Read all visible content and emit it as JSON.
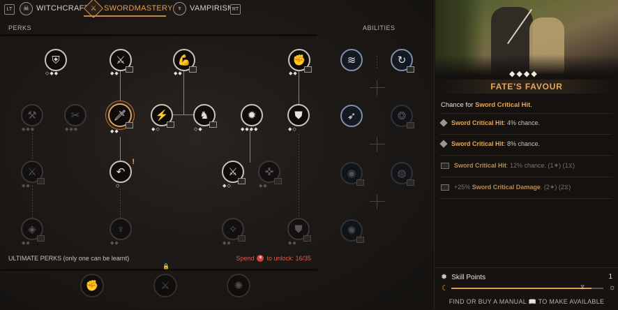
{
  "tabs": [
    {
      "key": "LT",
      "label": "WITCHCRAFT",
      "icon": "skull-icon",
      "active": false
    },
    {
      "key": "",
      "label": "SWORDMASTERY",
      "icon": "sword-icon",
      "active": true
    },
    {
      "key": "RT",
      "label": "VAMPIRISM",
      "icon": "vampire-icon",
      "active": false
    }
  ],
  "tab_keys": {
    "left": "LT",
    "right": "RT"
  },
  "sections": {
    "perks": "PERKS",
    "abilities": "ABILITIES"
  },
  "ultimate": {
    "label": "ULTIMATE PERKS (only one can be learnt)",
    "spend_prefix": "Spend",
    "spend_suffix": "to unlock: 16/35"
  },
  "perk_nodes": [
    {
      "id": "shield-perk",
      "diamonds": "◇◆◆",
      "locked": false
    },
    {
      "id": "slash-perk",
      "diamonds": "◆◆",
      "locked": false,
      "book": true
    },
    {
      "id": "flex-perk",
      "diamonds": "◆◆",
      "locked": false,
      "book": true
    },
    {
      "id": "fist-perk",
      "diamonds": "◆◆",
      "locked": false,
      "book": true
    },
    {
      "id": "locked-perk-a",
      "diamonds": "◆◆◆",
      "locked": true
    },
    {
      "id": "locked-perk-b",
      "diamonds": "◆◆◆",
      "locked": true
    },
    {
      "id": "fates-favour-perk",
      "diamonds": "◆◆",
      "locked": false,
      "book": true,
      "selected": true
    },
    {
      "id": "strike-perk",
      "diamonds": "◆◇",
      "locked": false,
      "book": true
    },
    {
      "id": "beast-perk",
      "diamonds": "◇◆",
      "locked": false,
      "book": true
    },
    {
      "id": "burst-perk",
      "diamonds": "◆◆◆◆",
      "locked": false
    },
    {
      "id": "armor-perk",
      "diamonds": "◆◇",
      "locked": false
    },
    {
      "id": "locked-perk-c",
      "diamonds": "◆◆",
      "locked": true,
      "book": true
    },
    {
      "id": "dodge-perk",
      "diamonds": "◇",
      "locked": false,
      "alert": "!"
    },
    {
      "id": "parry-perk",
      "diamonds": "◆◇",
      "locked": false,
      "book": true
    },
    {
      "id": "locked-perk-d",
      "diamonds": "◆◆",
      "locked": true,
      "book": true
    },
    {
      "id": "locked-perk-e",
      "diamonds": "◆◆",
      "locked": true,
      "book": true
    },
    {
      "id": "locked-perk-f",
      "diamonds": "◆◆",
      "locked": true
    },
    {
      "id": "locked-perk-g",
      "diamonds": "◆◆",
      "locked": true,
      "book": true
    },
    {
      "id": "locked-perk-h",
      "diamonds": "◆◆",
      "locked": true,
      "book": true
    }
  ],
  "ability_nodes": [
    {
      "id": "ability-wind",
      "locked": false
    },
    {
      "id": "ability-spin",
      "locked": false,
      "book": true
    },
    {
      "id": "ability-dash",
      "locked": false
    },
    {
      "id": "ability-locked-a",
      "locked": true,
      "book": true
    },
    {
      "id": "ability-locked-b",
      "locked": true,
      "book": true
    },
    {
      "id": "ability-locked-c",
      "locked": true,
      "book": true
    },
    {
      "id": "ability-locked-d",
      "locked": true,
      "book": true
    }
  ],
  "detail": {
    "rank_diamonds": "◆◆◆◆",
    "title": "FATE'S FAVOUR",
    "description_prefix": "Chance for",
    "description_highlight": "Sword Critical Hit",
    "description_suffix": ".",
    "ranks": [
      {
        "name": "Sword Critical Hit",
        "text": ": 4% chance.",
        "locked": false
      },
      {
        "name": "Sword Critical Hit",
        "text": ": 8% chance.",
        "locked": false
      },
      {
        "name": "Sword Critical Hit",
        "text": ": 12% chance. (1",
        "extra1": ") (1",
        "extra2": ")",
        "locked": true
      },
      {
        "prefix": "+25%",
        "name": "Sword Critical Damage",
        "text": ". (2",
        "extra1": ") (2",
        "extra2": ")",
        "locked": true
      }
    ]
  },
  "skill_points": {
    "label": "Skill Points",
    "value": "1",
    "progress": 0.92
  },
  "footer": {
    "prefix": "FIND OR BUY A MANUAL",
    "suffix": "TO MAKE AVAILABLE"
  }
}
